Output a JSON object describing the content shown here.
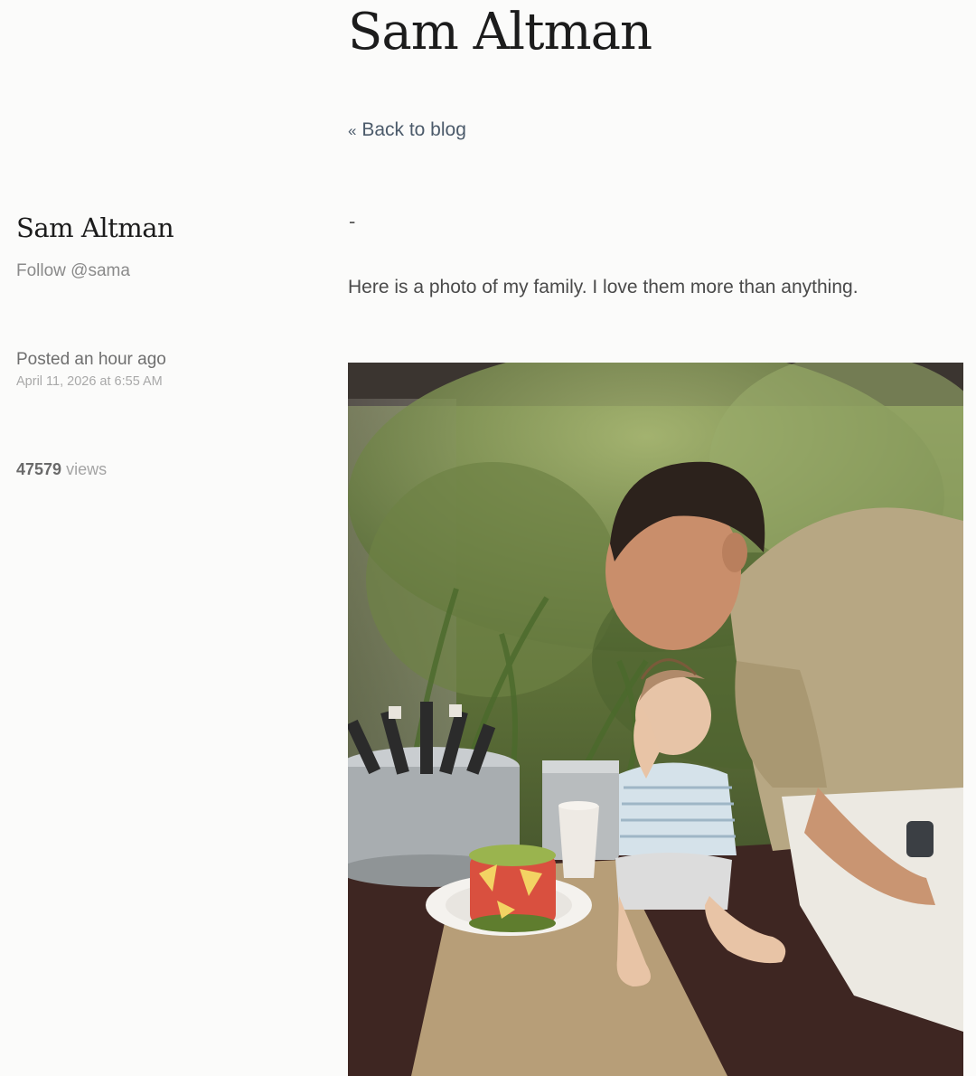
{
  "site": {
    "title": "Sam Altman",
    "back_link": "Back to blog",
    "back_arrows": "«"
  },
  "sidebar": {
    "author_name": "Sam Altman",
    "follow_label": "Follow @sama",
    "posted_relative": "Posted an hour ago",
    "posted_date": "April 11, 2026 at 6:55 AM",
    "views_count": "47579",
    "views_label": "views"
  },
  "post": {
    "title": "-",
    "body": "Here is a photo of my family. I love them more than anything.",
    "image_alt": "family-photo"
  }
}
